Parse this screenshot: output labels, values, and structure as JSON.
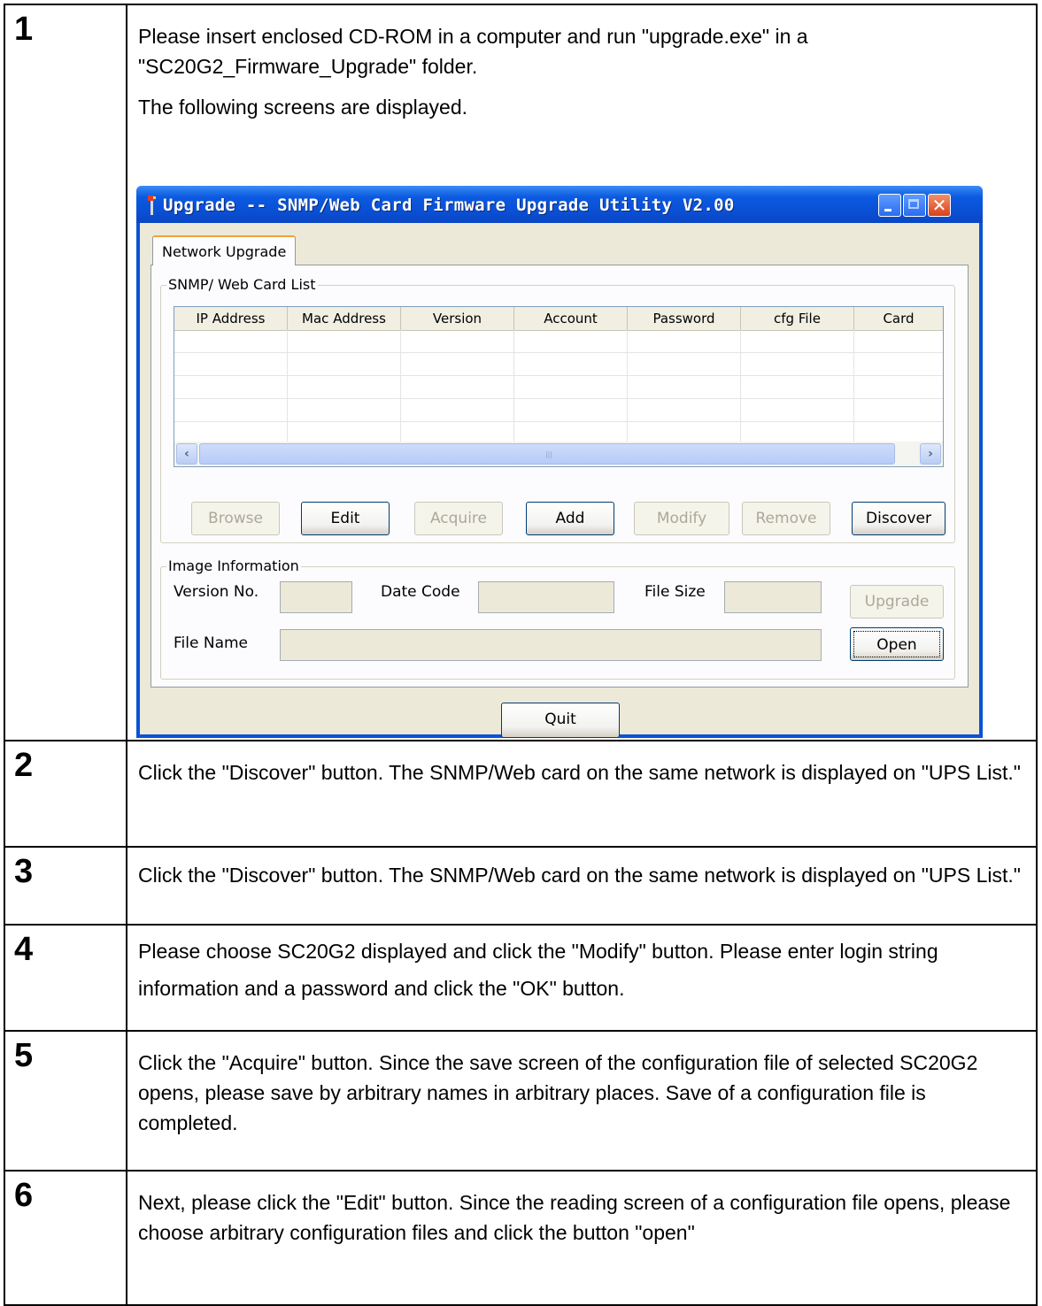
{
  "steps": [
    {
      "number": "1",
      "paragraphs": [
        "Please insert enclosed CD-ROM in a computer and run \"upgrade.exe\" in a \"SC20G2_Firmware_Upgrade\" folder.",
        "The following screens are displayed."
      ]
    },
    {
      "number": "2",
      "paragraphs": [
        "Click the \"Discover\" button. The SNMP/Web card on the same network is displayed on \"UPS List.\""
      ]
    },
    {
      "number": "3",
      "paragraphs": [
        "Click the \"Discover\" button. The SNMP/Web card on the same network is displayed on \"UPS List.\""
      ]
    },
    {
      "number": "4",
      "paragraphs": [
        "Please choose SC20G2 displayed and click the \"Modify\" button. Please enter login string information and a password and click the \"OK\" button."
      ]
    },
    {
      "number": "5",
      "paragraphs": [
        "Click the \"Acquire\" button. Since the save screen of the configuration file of selected SC20G2 opens, please save by arbitrary names in arbitrary places. Save of a configuration file is completed."
      ]
    },
    {
      "number": "6",
      "paragraphs": [
        "Next, please click the \"Edit\" button. Since the reading screen of a configuration file opens, please choose arbitrary configuration files and click the button \"open\""
      ]
    }
  ],
  "window": {
    "title": "Upgrade -- SNMP/Web Card Firmware Upgrade Utility V2.00",
    "tab_label": "Network Upgrade",
    "card_list": {
      "legend": "SNMP/ Web Card List",
      "columns": [
        "IP Address",
        "Mac Address",
        "Version",
        "Account",
        "Password",
        "cfg File",
        "Card"
      ],
      "buttons": {
        "browse": "Browse",
        "edit": "Edit",
        "acquire": "Acquire",
        "add": "Add",
        "modify": "Modify",
        "remove": "Remove",
        "discover": "Discover"
      }
    },
    "image_info": {
      "legend": "Image Information",
      "version_label": "Version No.",
      "date_code_label": "Date Code",
      "file_size_label": "File Size",
      "file_name_label": "File Name",
      "upgrade_button": "Upgrade",
      "open_button": "Open"
    },
    "quit_button": "Quit"
  },
  "colors": {
    "titlebar": "#0a52d8",
    "client_bg": "#ece9d8",
    "disabled_text": "#aca899"
  }
}
